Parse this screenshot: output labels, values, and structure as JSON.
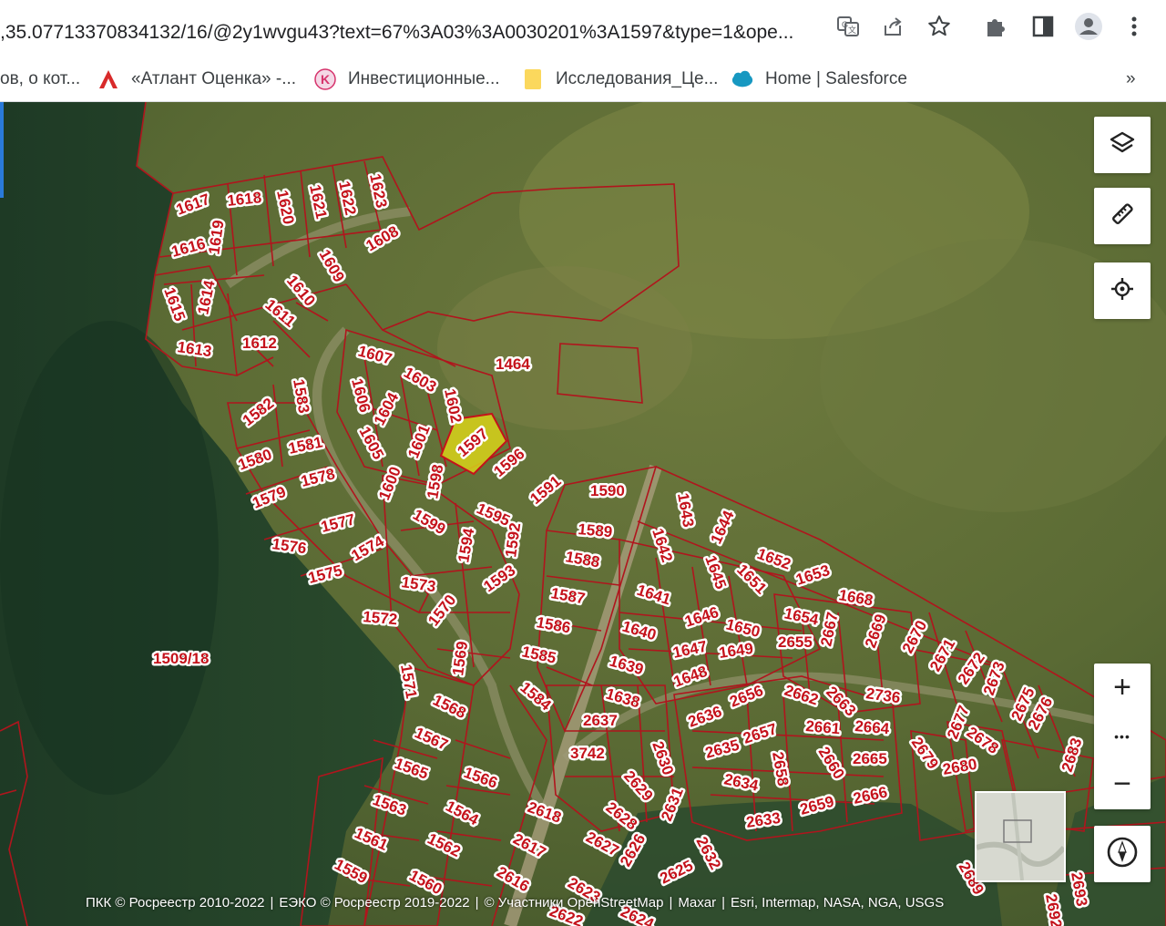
{
  "browser": {
    "url": ",35.07713370834132/16/@2y1wvgu43?text=67%3A03%3A0030201%3A1597&type=1&ope...",
    "icons": [
      "translate-icon",
      "share-icon",
      "star-icon",
      "extensions-icon",
      "sidebar-icon",
      "profile-icon",
      "menu-icon"
    ]
  },
  "bookmarks": {
    "items": [
      {
        "label": "ов, о кот...",
        "icon": "none"
      },
      {
        "label": "«Атлант Оценка» -...",
        "icon": "atlant-logo-icon"
      },
      {
        "label": "Инвестиционные...",
        "icon": "k-logo-icon"
      },
      {
        "label": "Исследования_Це...",
        "icon": "folder-icon"
      },
      {
        "label": "Home | Salesforce",
        "icon": "salesforce-cloud-icon"
      }
    ],
    "overflow_label": "»"
  },
  "map": {
    "selected_parcel": "1597",
    "highlight_color": "#d8d21a",
    "boundary_color": "#b0151d",
    "large_parcel_label": "1509/18",
    "parcels": [
      "1617",
      "1618",
      "1620",
      "1621",
      "1622",
      "1623",
      "1616",
      "1619",
      "1608",
      "1609",
      "1610",
      "1615",
      "1614",
      "1611",
      "1613",
      "1612",
      "1607",
      "1603",
      "1464",
      "1606",
      "1604",
      "1602",
      "1583",
      "1582",
      "1605",
      "1601",
      "1597",
      "1580",
      "1581",
      "1578",
      "1596",
      "1600",
      "1598",
      "1591",
      "1590",
      "1579",
      "1599",
      "1595",
      "1643",
      "1644",
      "1577",
      "1592",
      "1589",
      "1576",
      "1574",
      "1594",
      "1588",
      "1652",
      "1642",
      "1575",
      "1593",
      "1573",
      "1587",
      "1645",
      "1651",
      "1653",
      "1668",
      "1641",
      "1646",
      "1654",
      "1572",
      "1570",
      "1586",
      "1650",
      "1640",
      "2667",
      "2669",
      "2670",
      "2671",
      "2672",
      "1571",
      "1569",
      "1585",
      "1647",
      "1649",
      "2655",
      "1639",
      "1648",
      "2673",
      "2675",
      "2736",
      "2662",
      "2663",
      "1584",
      "1638",
      "1568",
      "2656",
      "2636",
      "2637",
      "2676",
      "2677",
      "2678",
      "2661",
      "2664",
      "1567",
      "2657",
      "3742",
      "2630",
      "2635",
      "2665",
      "2679",
      "2680",
      "2683",
      "1565",
      "1566",
      "2658",
      "2660",
      "2634",
      "2629",
      "1563",
      "1564",
      "2618",
      "2628",
      "2631",
      "2659",
      "2666",
      "2633",
      "1561",
      "1562",
      "2617",
      "2627",
      "2626",
      "2632",
      "1559",
      "1560",
      "2616",
      "2625",
      "2623",
      "2622",
      "2624",
      "2689",
      "2693",
      "2692"
    ],
    "attribution": [
      "ПКК © Росреестр 2010-2022",
      "ЕЭКО © Росреестр 2019-2022",
      "© Участники OpenStreetMap",
      "Maxar",
      "Esri, Intermap, NASA, NGA, USGS"
    ]
  },
  "controls": {
    "zoom_in_label": "+",
    "zoom_more_label": "•••",
    "zoom_out_label": "−"
  }
}
